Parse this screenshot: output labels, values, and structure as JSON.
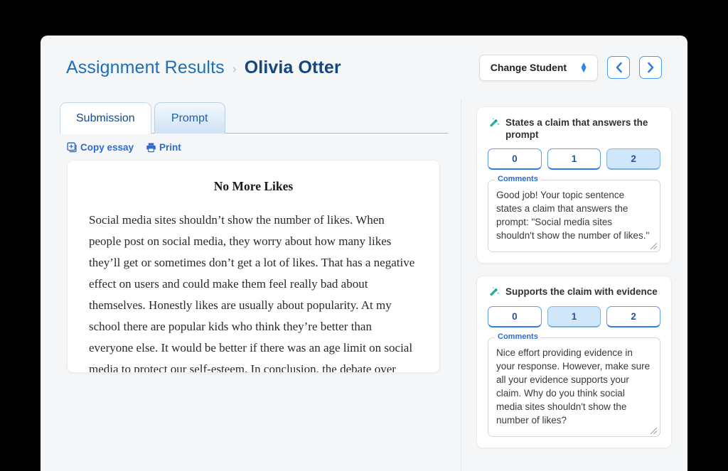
{
  "header": {
    "breadcrumb_root": "Assignment Results",
    "breadcrumb_separator": "›",
    "breadcrumb_current": "Olivia Otter",
    "change_student_label": "Change Student",
    "prev_button_icon": "chevron-left-icon",
    "next_button_icon": "chevron-right-icon"
  },
  "tabs": [
    {
      "label": "Submission",
      "active": true
    },
    {
      "label": "Prompt",
      "active": false
    }
  ],
  "tools": [
    {
      "label": "Copy essay",
      "icon": "copy-icon"
    },
    {
      "label": "Print",
      "icon": "print-icon"
    }
  ],
  "essay": {
    "title": "No More Likes",
    "body": "Social media sites shouldn’t show the number of likes. When people post on social media, they worry about how many likes they’ll get or sometimes don’t get a lot of likes. That has a negative effect on users and could make them feel really bad about themselves. Honestly likes are usually about popularity. At my school there are popular kids who think they’re better than everyone else. It would be better if there was an age limit on social media to protect our self-esteem. In conclusion, the debate over likes on social media is important."
  },
  "rubric": {
    "comments_legend": "Comments",
    "score_options": [
      "0",
      "1",
      "2"
    ],
    "items": [
      {
        "icon": "magic-wand-icon",
        "title": "States a claim that answers the prompt",
        "selected_score": "2",
        "comment": "Good job! Your topic sentence states a claim that answers the prompt: \"Social media sites shouldn't show the number of likes.\""
      },
      {
        "icon": "magic-wand-icon",
        "title": "Supports the claim with evidence",
        "selected_score": "1",
        "comment": "Nice effort providing evidence in your response. However, make sure all your evidence supports your claim. Why do you think social media sites shouldn't show the number of likes?"
      }
    ]
  },
  "colors": {
    "accent_blue": "#2b6cd4",
    "crumb_blue": "#1f6fb5",
    "crumb_dark": "#12477f",
    "selected_score_bg": "#cfe7f8",
    "wand_teal": "#26b0a0",
    "page_bg": "#f5f6f7"
  }
}
